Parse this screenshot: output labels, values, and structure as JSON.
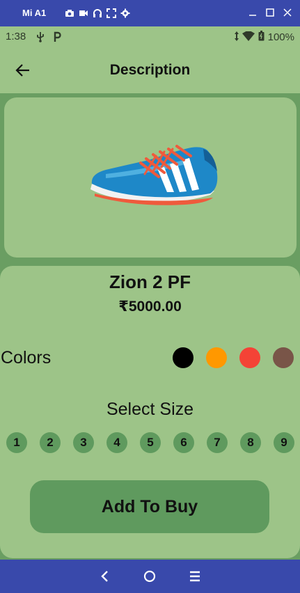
{
  "window": {
    "title": "Mi A1",
    "tools": [
      "camera-icon",
      "video-icon",
      "headset-icon",
      "fullscreen-icon",
      "settings-icon"
    ],
    "controls": [
      "minimize-icon",
      "maximize-icon",
      "close-icon"
    ]
  },
  "status_bar": {
    "time": "1:38",
    "battery": "100%",
    "left_icons": [
      "usb-icon",
      "parking-icon"
    ],
    "right_icons": [
      "data-arrows-icon",
      "wifi-icon",
      "battery-icon"
    ]
  },
  "app_bar": {
    "title": "Description",
    "back_icon": "arrow-back-icon"
  },
  "product": {
    "name": "Zion 2 PF",
    "price": "₹5000.00",
    "image_icon": "running-shoe-image"
  },
  "colors": {
    "label": "Colors",
    "swatches": [
      "#000000",
      "#ff9800",
      "#f44336",
      "#795548"
    ]
  },
  "sizes": {
    "title": "Select Size",
    "options": [
      "1",
      "2",
      "3",
      "4",
      "5",
      "6",
      "7",
      "8",
      "9"
    ]
  },
  "actions": {
    "add_to_buy": "Add To Buy"
  },
  "nav_bar": {
    "icons": [
      "nav-back-icon",
      "nav-home-icon",
      "nav-menu-icon"
    ]
  },
  "theme": {
    "background": "#9dc488",
    "accent": "#5f9a5e",
    "frame": "#3949ab"
  }
}
